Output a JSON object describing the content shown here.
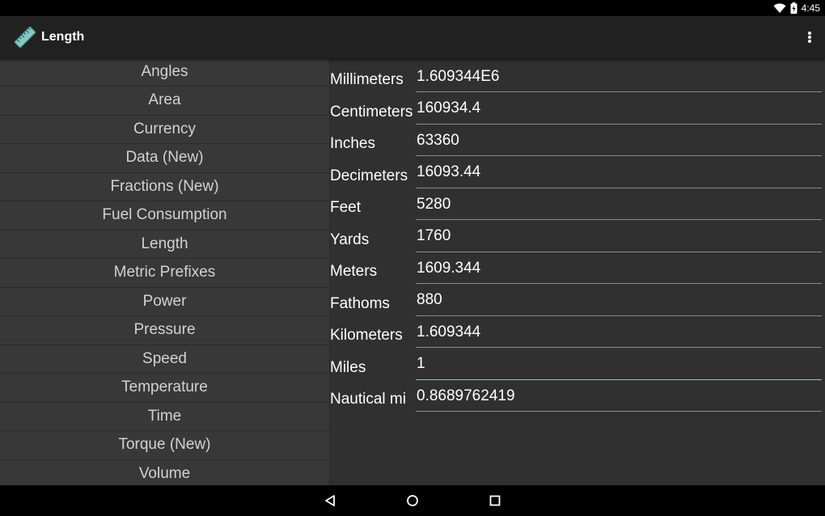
{
  "status": {
    "time": "4:45"
  },
  "app": {
    "title": "Length",
    "accent": "#80cbc4"
  },
  "sidebar": {
    "items": [
      {
        "label": "Angles"
      },
      {
        "label": "Area"
      },
      {
        "label": "Currency"
      },
      {
        "label": "Data (New)"
      },
      {
        "label": "Fractions (New)"
      },
      {
        "label": "Fuel Consumption"
      },
      {
        "label": "Length"
      },
      {
        "label": "Metric Prefixes"
      },
      {
        "label": "Power"
      },
      {
        "label": "Pressure"
      },
      {
        "label": "Speed"
      },
      {
        "label": "Temperature"
      },
      {
        "label": "Time"
      },
      {
        "label": "Torque (New)"
      },
      {
        "label": "Volume"
      }
    ]
  },
  "units": [
    {
      "label": "Millimeters",
      "value": "1.609344E6"
    },
    {
      "label": "Centimeters",
      "value": "160934.4"
    },
    {
      "label": "Inches",
      "value": "63360"
    },
    {
      "label": "Decimeters",
      "value": "16093.44"
    },
    {
      "label": "Feet",
      "value": "5280"
    },
    {
      "label": "Yards",
      "value": "1760"
    },
    {
      "label": "Meters",
      "value": "1609.344"
    },
    {
      "label": "Fathoms",
      "value": "880"
    },
    {
      "label": "Kilometers",
      "value": "1.609344"
    },
    {
      "label": "Miles",
      "value": "1"
    },
    {
      "label": "Nautical mi",
      "value": "0.8689762419"
    }
  ],
  "icons": {
    "app": "ruler-icon",
    "menu": "overflow-menu-icon",
    "wifi": "wifi-icon",
    "battery": "battery-icon",
    "back": "back-icon",
    "home": "home-icon",
    "recents": "recents-icon"
  }
}
